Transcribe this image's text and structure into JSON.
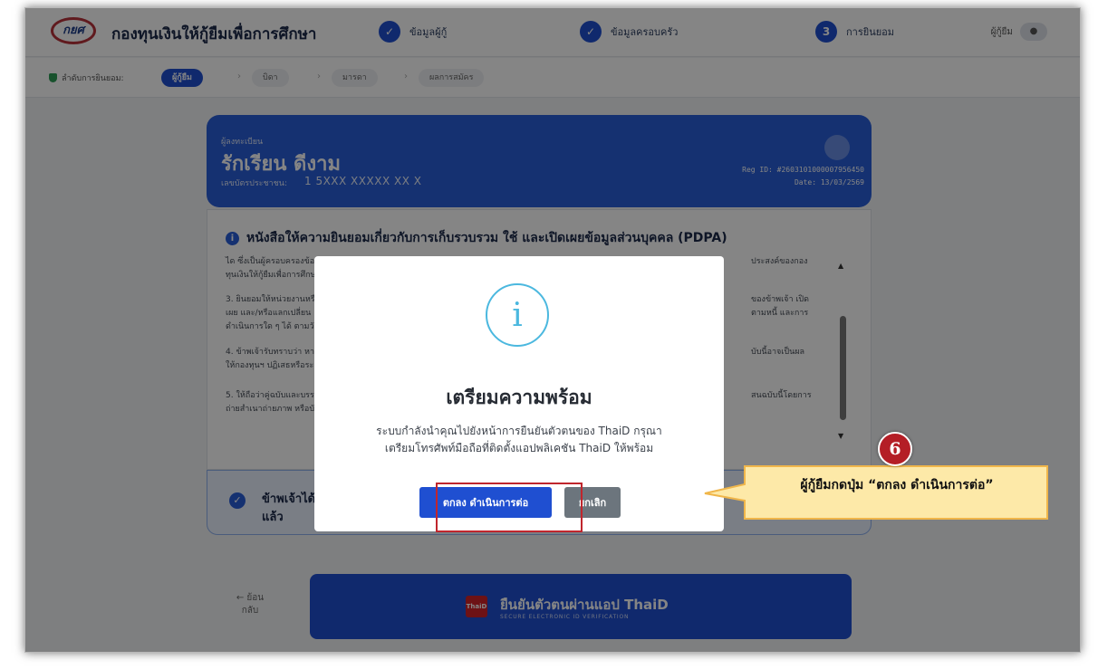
{
  "header": {
    "logo_text": "กยศ",
    "brand": "กองทุนเงินให้กู้ยืมเพื่อการศึกษา",
    "steps": [
      {
        "label": "ข้อมูลผู้กู้",
        "marker": "✓"
      },
      {
        "label": "ข้อมูลครอบครัว",
        "marker": "✓"
      },
      {
        "label": "การยินยอม",
        "marker": "3"
      }
    ],
    "user_label": "ผู้กู้ยืม",
    "user_icon": "person-icon"
  },
  "breadcrumb": {
    "lead": "ลำดับการยินยอม:",
    "items": [
      {
        "label": "ผู้กู้ยืม",
        "state": "active"
      },
      {
        "label": "บิดา",
        "state": "idle"
      },
      {
        "label": "มารดา",
        "state": "idle"
      },
      {
        "label": "ผลการสมัคร",
        "state": "idle"
      }
    ],
    "separator": "›"
  },
  "registrant": {
    "caption": "ผู้ลงทะเบียน",
    "name": "รักเรียน ดีงาม",
    "id_label": "เลขบัตรประชาชน:",
    "id_value": "1 5XXX XXXXX XX X",
    "reg_id": "Reg ID: #2603101000007956450",
    "date": "Date: 13/03/2569"
  },
  "pdpa": {
    "title": "หนังสือให้ความยินยอมเกี่ยวกับการเก็บรวบรวม ใช้ และเปิดเผยข้อมูลส่วนบุคคล (PDPA)",
    "paragraphs": [
      {
        "left_1": "ได ซึ่งเป็นผู้ครอบครองข้อ",
        "left_2": "ทุนเงินให้กู้ยืมเพื่อการศึกษ",
        "right_1": "ประสงค์ของกอง"
      },
      {
        "left_1": "3. ยินยอมให้หน่วยงานหรื",
        "left_2": "เผย และ/หรือแลกเปลี่ยน",
        "left_3": "ดำเนินการใด ๆ ได้ ตามวัต",
        "right_1": "ของข้าพเจ้า เปิด",
        "right_2": "ตามหนี้ และการ"
      },
      {
        "left_1": "4. ข้าพเจ้ารับทราบว่า หา",
        "left_2": "ให้กองทุนฯ ปฏิเสธหรือระ",
        "right_1": "บับนี้อาจเป็นผล"
      },
      {
        "left_1": "5. ให้ถือว่าคู่ฉบับและบรร",
        "left_2": "ถ่ายสำเนาถ่ายภาพ หรือบั",
        "right_1": "สนฉบับนี้โดยการ"
      }
    ]
  },
  "consent": {
    "line1": "ข้าพเจ้าได้อ่",
    "line2": "แล้ว"
  },
  "footer": {
    "back_label": "← ย้อน\nกลับ",
    "thaid_logo": "ThaiD",
    "thaid_title": "ยืนยันตัวตนผ่านแอป ThaiD",
    "thaid_sub": "SECURE ELECTRONIC ID VERIFICATION"
  },
  "modal": {
    "icon": "info-icon",
    "icon_glyph": "i",
    "title": "เตรียมความพร้อม",
    "line1": "ระบบกำลังนำคุณไปยังหน้าการยืนยันตัวตนของ ThaiD กรุณา",
    "line2": "เตรียมโทรศัพท์มือถือที่ติดตั้งแอปพลิเคชัน ThaiD ให้พร้อม",
    "confirm_label": "ตกลง ดำเนินการต่อ",
    "cancel_label": "ยกเลิก"
  },
  "annotation": {
    "step_number": "6",
    "callout": "ผู้กู้ยืมกดปุ่ม “ตกลง ดำเนินการต่อ”",
    "highlight_color": "#c0262d",
    "callout_fill": "#fde9a8",
    "callout_stroke": "#f0b64a"
  },
  "colors": {
    "primary": "#1f4fd1",
    "card_blue": "#2a5fd8",
    "modal_icon": "#4bb8df",
    "cancel_gray": "#6c757d",
    "badge_red": "#b41e26"
  }
}
